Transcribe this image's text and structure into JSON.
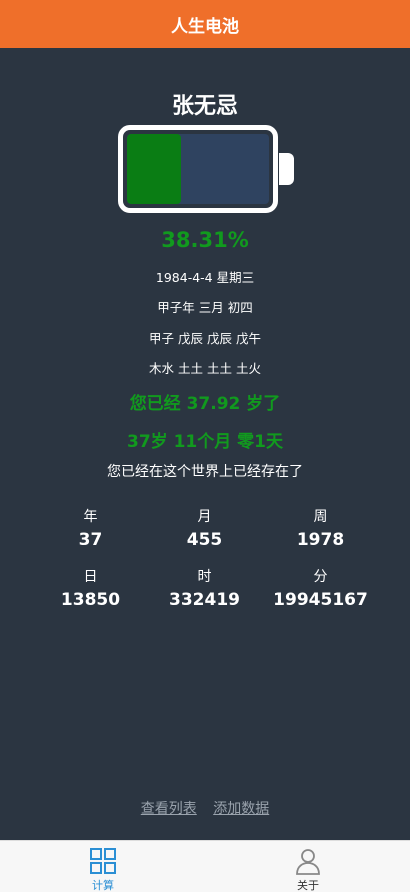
{
  "header": {
    "title": "人生电池"
  },
  "person": {
    "name": "张无忌"
  },
  "battery": {
    "percent_text": "38.31%",
    "fill_fraction": 0.3831,
    "fill_color": "#0a7d14"
  },
  "info": {
    "solar_date": "1984-4-4 星期三",
    "lunar_date": "甲子年 三月 初四",
    "ganzhi": "甲子 戊辰 戊辰 戊午",
    "wuxing": "木水 土土 土土 土火"
  },
  "age": {
    "decimal_text": "您已经 37.92 岁了",
    "detail_text": "37岁 11个月 零1天",
    "exist_text": "您已经在这个世界上已经存在了"
  },
  "stats": {
    "year": {
      "label": "年",
      "value": "37"
    },
    "month": {
      "label": "月",
      "value": "455"
    },
    "week": {
      "label": "周",
      "value": "1978"
    },
    "day": {
      "label": "日",
      "value": "13850"
    },
    "hour": {
      "label": "时",
      "value": "332419"
    },
    "minute": {
      "label": "分",
      "value": "19945167"
    }
  },
  "links": {
    "view_list": "查看列表",
    "add_data": "添加数据"
  },
  "tabbar": {
    "calc": {
      "label": "计算",
      "icon": "grid-icon",
      "active": true
    },
    "about": {
      "label": "关于",
      "icon": "user-icon",
      "active": false
    }
  },
  "colors": {
    "header": "#ef6f2a",
    "background": "#2b3541",
    "accent_green": "#119a1e",
    "tab_active": "#2b8fd4"
  }
}
